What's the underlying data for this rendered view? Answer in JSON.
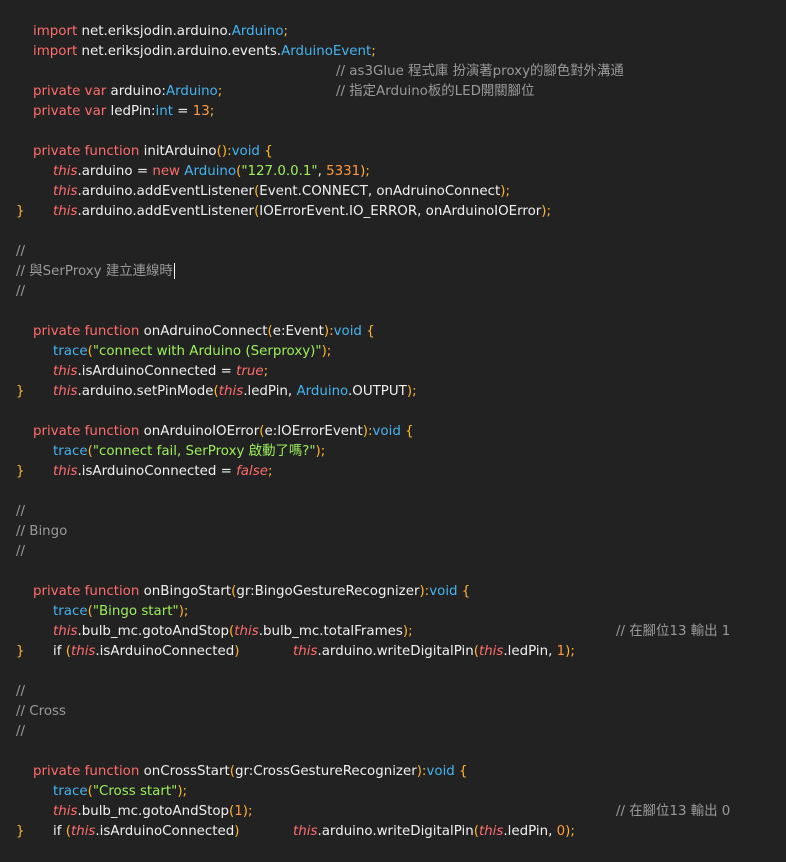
{
  "code": {
    "imp1": [
      "import",
      " net.eriksjodin.arduino.",
      "Arduino",
      ";"
    ],
    "imp2": [
      "import",
      " net.eriksjodin.arduino.events.",
      "ArduinoEvent",
      ";"
    ],
    "var1": [
      "private",
      " ",
      "var",
      " arduino:",
      "Arduino",
      ";",
      "// as3Glue 程式庫 扮演著proxy的腳色對外溝通"
    ],
    "var2": [
      "private",
      " ",
      "var",
      " ledPin:",
      "int",
      " = ",
      "13",
      ";",
      "// 指定Arduino板的LED開關腳位"
    ],
    "init": [
      "private",
      " ",
      "function",
      " initArduino",
      "():",
      "void",
      " {"
    ],
    "init1": [
      "this",
      ".arduino = ",
      "new",
      " ",
      "Arduino",
      "(",
      "\"127.0.0.1\"",
      ", ",
      "5331",
      ");"
    ],
    "init2": [
      "this",
      ".arduino.addEventListener",
      "(",
      "Event.CONNECT, onAdruinoConnect",
      ");"
    ],
    "init3": [
      "this",
      ".arduino.addEventListener",
      "(",
      "IOErrorEvent.IO_ERROR, onArduinoIOError",
      ");"
    ],
    "close": "}",
    "cslash": "//",
    "c_serproxy": "// 與SerProxy 建立連線時",
    "onconn": [
      "private",
      " ",
      "function",
      " onAdruinoConnect",
      "(",
      "e:Event",
      "):",
      "void",
      " {"
    ],
    "onconn1": [
      "trace",
      "(",
      "\"connect with Arduino (Serproxy)\"",
      ");"
    ],
    "onconn2": [
      "this",
      ".isArduinoConnected = ",
      "true",
      ";"
    ],
    "onconn3": [
      "this",
      ".arduino.setPinMode",
      "(",
      "this",
      ".ledPin, ",
      "Arduino",
      ".OUTPUT",
      ");"
    ],
    "onerr": [
      "private",
      " ",
      "function",
      " onArduinoIOError",
      "(",
      "e:IOErrorEvent",
      "):",
      "void",
      " {"
    ],
    "onerr1": [
      "trace",
      "(",
      "\"connect fail, SerProxy 啟動了嗎?\"",
      ");"
    ],
    "onerr2": [
      "this",
      ".isArduinoConnected = ",
      "false",
      ";"
    ],
    "c_bingo": "// Bingo",
    "bingo": [
      "private",
      " ",
      "function",
      " onBingoStart",
      "(",
      "gr:BingoGestureRecognizer",
      "):",
      "void",
      " {"
    ],
    "bingo1": [
      "trace",
      "(",
      "\"Bingo start\"",
      ");"
    ],
    "bingo2": [
      "this",
      ".bulb_mc.gotoAndStop",
      "(",
      "this",
      ".bulb_mc.totalFrames",
      ");"
    ],
    "bingo3a": [
      "if",
      " (",
      "this",
      ".isArduinoConnected",
      ")"
    ],
    "bingo3b": [
      "this",
      ".arduino.writeDigitalPin",
      "(",
      "this",
      ".ledPin, ",
      "1",
      ");"
    ],
    "bingo3c": "// 在腳位13 輸出 1",
    "c_cross": "// Cross",
    "cross": [
      "private",
      " ",
      "function",
      " onCrossStart",
      "(",
      "gr:CrossGestureRecognizer",
      "):",
      "void",
      " {"
    ],
    "cross1": [
      "trace",
      "(",
      "\"Cross start\"",
      ");"
    ],
    "cross2": [
      "this",
      ".bulb_mc.gotoAndStop",
      "(",
      "1",
      ");"
    ],
    "cross3a": [
      "if",
      " (",
      "this",
      ".isArduinoConnected",
      ")"
    ],
    "cross3b": [
      "this",
      ".arduino.writeDigitalPin",
      "(",
      "this",
      ".ledPin, ",
      "0",
      ");"
    ],
    "cross3c": "// 在腳位13 輸出 0"
  },
  "colors": {
    "background": "#222222",
    "keyword": "#ff6c6c",
    "type": "#44b4f0",
    "string": "#9df05a",
    "number": "#ff9a3c",
    "comment": "#9a9a9a",
    "punct": "#ffb432",
    "text": "#f0f0f0"
  }
}
